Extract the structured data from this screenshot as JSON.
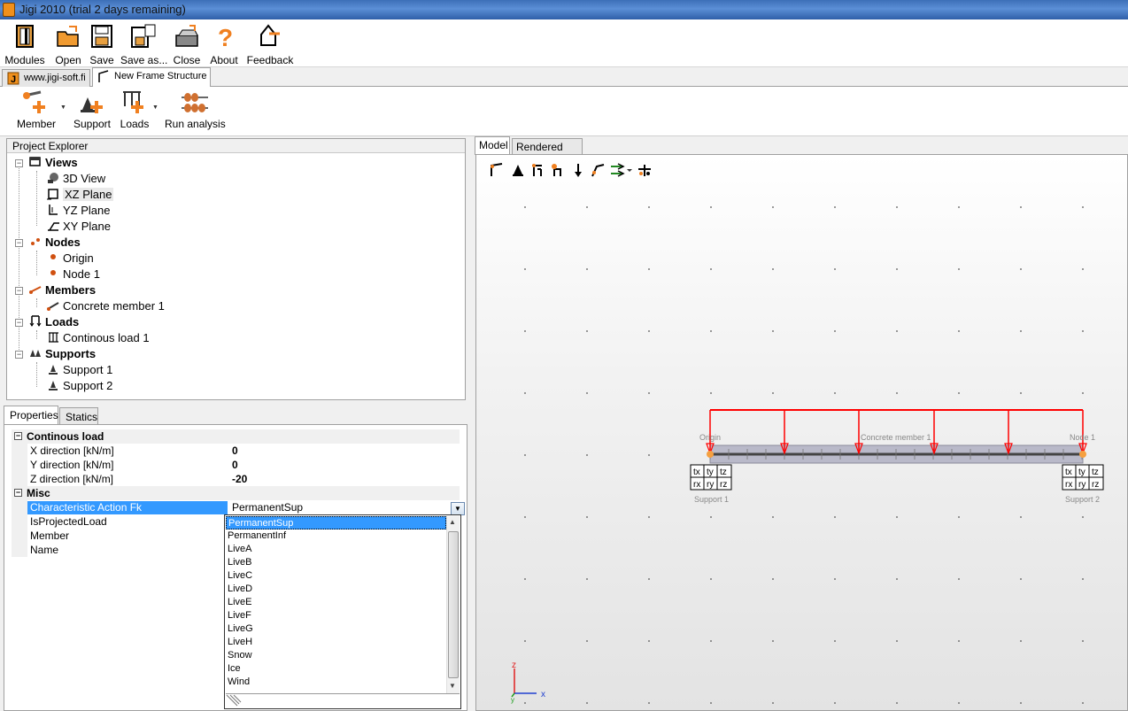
{
  "window": {
    "title": "Jigi 2010 (trial 2 days remaining)"
  },
  "main_toolbar": {
    "modules": "Modules",
    "open": "Open",
    "save": "Save",
    "save_as": "Save as...",
    "close": "Close",
    "about": "About",
    "feedback": "Feedback"
  },
  "doc_tabs": {
    "website": "www.jigi-soft.fi",
    "frame": "New Frame Structure"
  },
  "frame_toolbar": {
    "member": "Member",
    "support": "Support",
    "loads": "Loads",
    "run_analysis": "Run analysis"
  },
  "explorer": {
    "title": "Project Explorer",
    "views": {
      "label": "Views",
      "items": [
        "3D View",
        "XZ Plane",
        "YZ Plane",
        "XY Plane"
      ]
    },
    "nodes": {
      "label": "Nodes",
      "items": [
        "Origin",
        "Node 1"
      ]
    },
    "members": {
      "label": "Members",
      "items": [
        "Concrete member 1"
      ]
    },
    "loads": {
      "label": "Loads",
      "items": [
        "Continous load 1"
      ]
    },
    "supports": {
      "label": "Supports",
      "items": [
        "Support 1",
        "Support 2"
      ]
    }
  },
  "prop_tabs": {
    "properties": "Properties",
    "statics": "Statics"
  },
  "properties": {
    "cat_load": "Continous load",
    "x_dir": {
      "name": "X direction [kN/m]",
      "value": "0"
    },
    "y_dir": {
      "name": "Y direction [kN/m]",
      "value": "0"
    },
    "z_dir": {
      "name": "Z direction [kN/m]",
      "value": "-20"
    },
    "cat_misc": "Misc",
    "char_action": {
      "name": "Characteristic Action Fk",
      "value": "PermanentSup"
    },
    "is_projected": {
      "name": "IsProjectedLoad"
    },
    "member": {
      "name": "Member"
    },
    "name_field": {
      "name": "Name"
    }
  },
  "dropdown_options": [
    "PermanentSup",
    "PermanentInf",
    "LiveA",
    "LiveB",
    "LiveC",
    "LiveD",
    "LiveE",
    "LiveF",
    "LiveG",
    "LiveH",
    "Snow",
    "Ice",
    "Wind"
  ],
  "view_tabs": {
    "model": "Model",
    "rendered": "Rendered view"
  },
  "model": {
    "node_origin": "Origin",
    "node_1": "Node 1",
    "member_label": "Concrete member 1",
    "support_1": "Support 1",
    "support_2": "Support 2",
    "dof": [
      "tx",
      "ty",
      "tz",
      "rx",
      "ry",
      "rz"
    ],
    "axis_z": "z",
    "axis_x": "x",
    "axis_y": "y"
  },
  "colors": {
    "load": "#ff0000",
    "node": "#f5a040",
    "selection": "#3399ff"
  }
}
